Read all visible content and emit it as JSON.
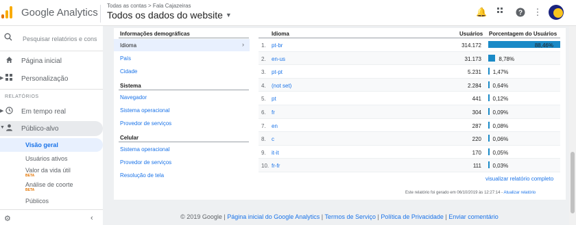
{
  "header": {
    "app_name": "Google Analytics",
    "breadcrumb": "Todas as contas > Fala Cajazeiras",
    "view_name": "Todos os dados do website"
  },
  "colors": {
    "accent": "#1a73e8",
    "bar": "#1a8ac7",
    "logo": [
      "#f9ab00",
      "#e37400",
      "#e37400"
    ]
  },
  "sidebar": {
    "search_placeholder": "Pesquisar relatórios e conse",
    "items": [
      {
        "label": "Página inicial",
        "icon": "home-icon"
      },
      {
        "label": "Personalização",
        "icon": "grid-icon"
      }
    ],
    "section_label": "RELATÓRIOS",
    "reports": [
      {
        "label": "Em tempo real",
        "icon": "clock-icon"
      },
      {
        "label": "Público-alvo",
        "icon": "person-icon"
      }
    ],
    "sub_items": [
      {
        "label": "Visão geral",
        "beta": ""
      },
      {
        "label": "Usuários ativos",
        "beta": ""
      },
      {
        "label": "Valor da vida útil",
        "beta": "BETA"
      },
      {
        "label": "Análise de coorte",
        "beta": "BETA"
      },
      {
        "label": "Públicos",
        "beta": ""
      }
    ]
  },
  "left_panel": {
    "demographics_title": "Informações demográficas",
    "demographics_links": [
      "Idioma",
      "País",
      "Cidade"
    ],
    "system_title": "Sistema",
    "system_links": [
      "Navegador",
      "Sistema operacional",
      "Provedor de serviços"
    ],
    "mobile_title": "Celular",
    "mobile_links": [
      "Sistema operacional",
      "Provedor de serviços",
      "Resolução de tela"
    ]
  },
  "table": {
    "columns": {
      "language": "Idioma",
      "users": "Usuários",
      "percent": "Porcentagem do Usuários"
    },
    "rows": [
      {
        "idx": "1.",
        "lang": "pt-br",
        "users": "314.172",
        "pct": "88,46%",
        "share": 88.46
      },
      {
        "idx": "2.",
        "lang": "en-us",
        "users": "31.173",
        "pct": "8,78%",
        "share": 8.78
      },
      {
        "idx": "3.",
        "lang": "pt-pt",
        "users": "5.231",
        "pct": "1,47%",
        "share": 1.47
      },
      {
        "idx": "4.",
        "lang": "(not set)",
        "users": "2.284",
        "pct": "0,64%",
        "share": 0.64
      },
      {
        "idx": "5.",
        "lang": "pt",
        "users": "441",
        "pct": "0,12%",
        "share": 0.12
      },
      {
        "idx": "6.",
        "lang": "fr",
        "users": "304",
        "pct": "0,09%",
        "share": 0.09
      },
      {
        "idx": "7.",
        "lang": "en",
        "users": "287",
        "pct": "0,08%",
        "share": 0.08
      },
      {
        "idx": "8.",
        "lang": "c",
        "users": "220",
        "pct": "0,06%",
        "share": 0.06
      },
      {
        "idx": "9.",
        "lang": "it-it",
        "users": "170",
        "pct": "0,05%",
        "share": 0.05
      },
      {
        "idx": "10.",
        "lang": "fr-fr",
        "users": "111",
        "pct": "0,03%",
        "share": 0.03
      }
    ],
    "full_report_link": "visualizar relatório completo",
    "generated_note": "Este relatório foi gerado em 06/10/2019 às 12:27:14 - ",
    "update_link": "Atualizar relatório"
  },
  "footer": {
    "copyright": "© 2019 Google",
    "links": [
      "Página inicial do Google Analytics",
      "Termos de Serviço",
      "Política de Privacidade",
      "Enviar comentário"
    ]
  }
}
